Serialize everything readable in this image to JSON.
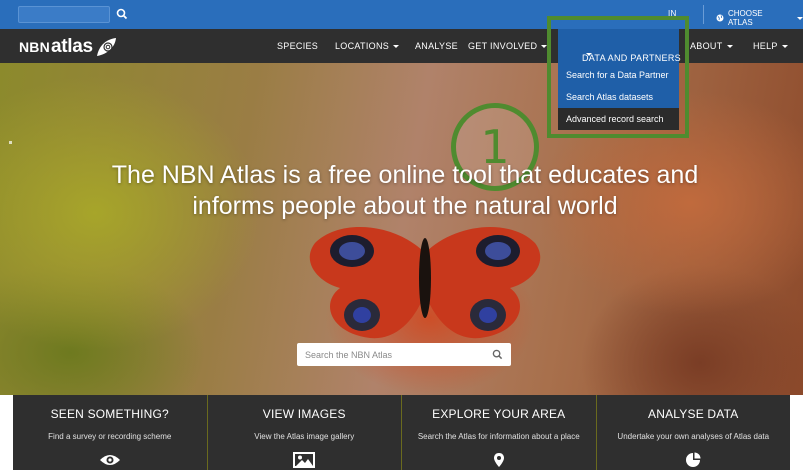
{
  "topbar": {
    "search_placeholder": "",
    "signin_label": "IN",
    "choose_atlas_label": "CHOOSE ATLAS"
  },
  "logo": {
    "nbn": "NBN",
    "atlas": "atlas"
  },
  "nav": {
    "items": [
      {
        "label": "SPECIES"
      },
      {
        "label": "LOCATIONS"
      },
      {
        "label": "ANALYSE"
      },
      {
        "label": "GET INVOLVED"
      },
      {
        "label": "DATA AND PARTNERS"
      },
      {
        "label": "ABOUT"
      },
      {
        "label": "HELP"
      }
    ]
  },
  "dropdown": {
    "items": [
      {
        "label": "Search for a Data Partner"
      },
      {
        "label": "Search Atlas datasets"
      },
      {
        "label": "Advanced record search"
      }
    ]
  },
  "annotation": {
    "number": "1",
    "color": "#4f8b2f"
  },
  "hero": {
    "title": "The NBN Atlas is a free online tool that educates and informs people about the natural world",
    "search_placeholder": "Search the NBN Atlas"
  },
  "tiles": [
    {
      "title": "SEEN SOMETHING?",
      "subtitle": "Find a survey or recording scheme",
      "icon": "eye-icon"
    },
    {
      "title": "VIEW IMAGES",
      "subtitle": "View the Atlas image gallery",
      "icon": "image-icon"
    },
    {
      "title": "EXPLORE YOUR AREA",
      "subtitle": "Search the Atlas for information about a place",
      "icon": "map-pin-icon"
    },
    {
      "title": "ANALYSE DATA",
      "subtitle": "Undertake your own analyses of Atlas data",
      "icon": "pie-chart-icon"
    }
  ],
  "colors": {
    "topbar": "#2a6ebb",
    "navbar": "#2f2f2f",
    "dropdown": "#1f5fa8",
    "highlight": "#4f8b2f"
  }
}
